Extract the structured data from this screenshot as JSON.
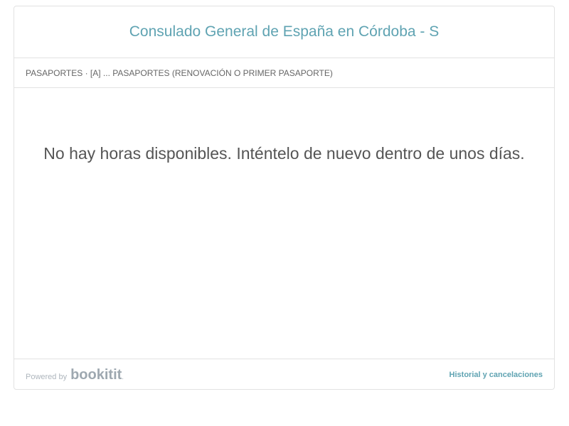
{
  "header": {
    "title": "Consulado General de España en Córdoba - S"
  },
  "breadcrumb": {
    "text": "PASAPORTES · [A] ... PASAPORTES (RENOVACIÓN O PRIMER PASAPORTE)"
  },
  "main": {
    "message": "No hay horas disponibles. Inténtelo de nuevo dentro de unos días."
  },
  "footer": {
    "powered_label": "Powered by",
    "logo_text": "bookitit",
    "logo_suffix": ".",
    "history_link": "Historial y cancelaciones"
  },
  "colors": {
    "accent": "#5fa3b2",
    "text": "#555555",
    "border": "#e2e2e2",
    "logo": "#9ea8b0"
  }
}
